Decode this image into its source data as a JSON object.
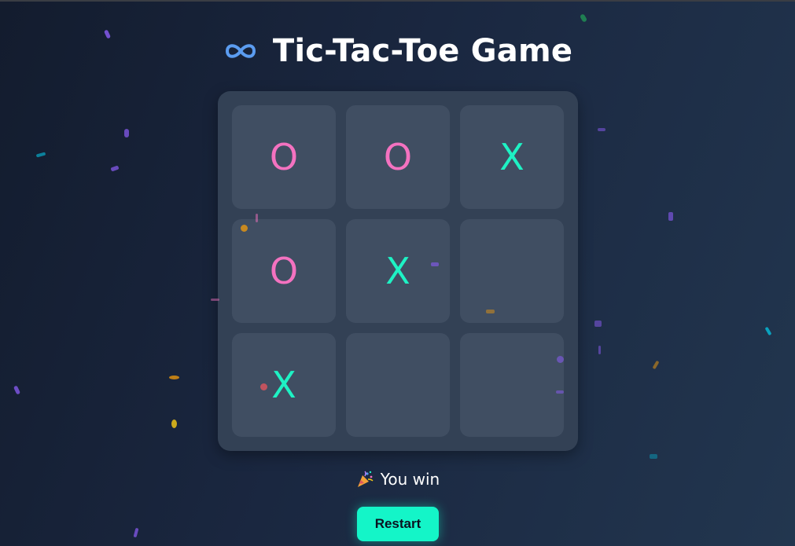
{
  "app": {
    "title": "Tic-Tac-Toe Game",
    "title_icon": "infinity-icon"
  },
  "board": {
    "cells": [
      "O",
      "O",
      "X",
      "O",
      "X",
      "",
      "X",
      "",
      ""
    ]
  },
  "status": {
    "icon": "party-popper-icon",
    "text": "You win"
  },
  "controls": {
    "restart_label": "Restart"
  },
  "colors": {
    "x_mark": "#1ef2c4",
    "o_mark": "#f472c0",
    "accent": "#14f5c8",
    "title_icon": "#5b9cf0"
  }
}
